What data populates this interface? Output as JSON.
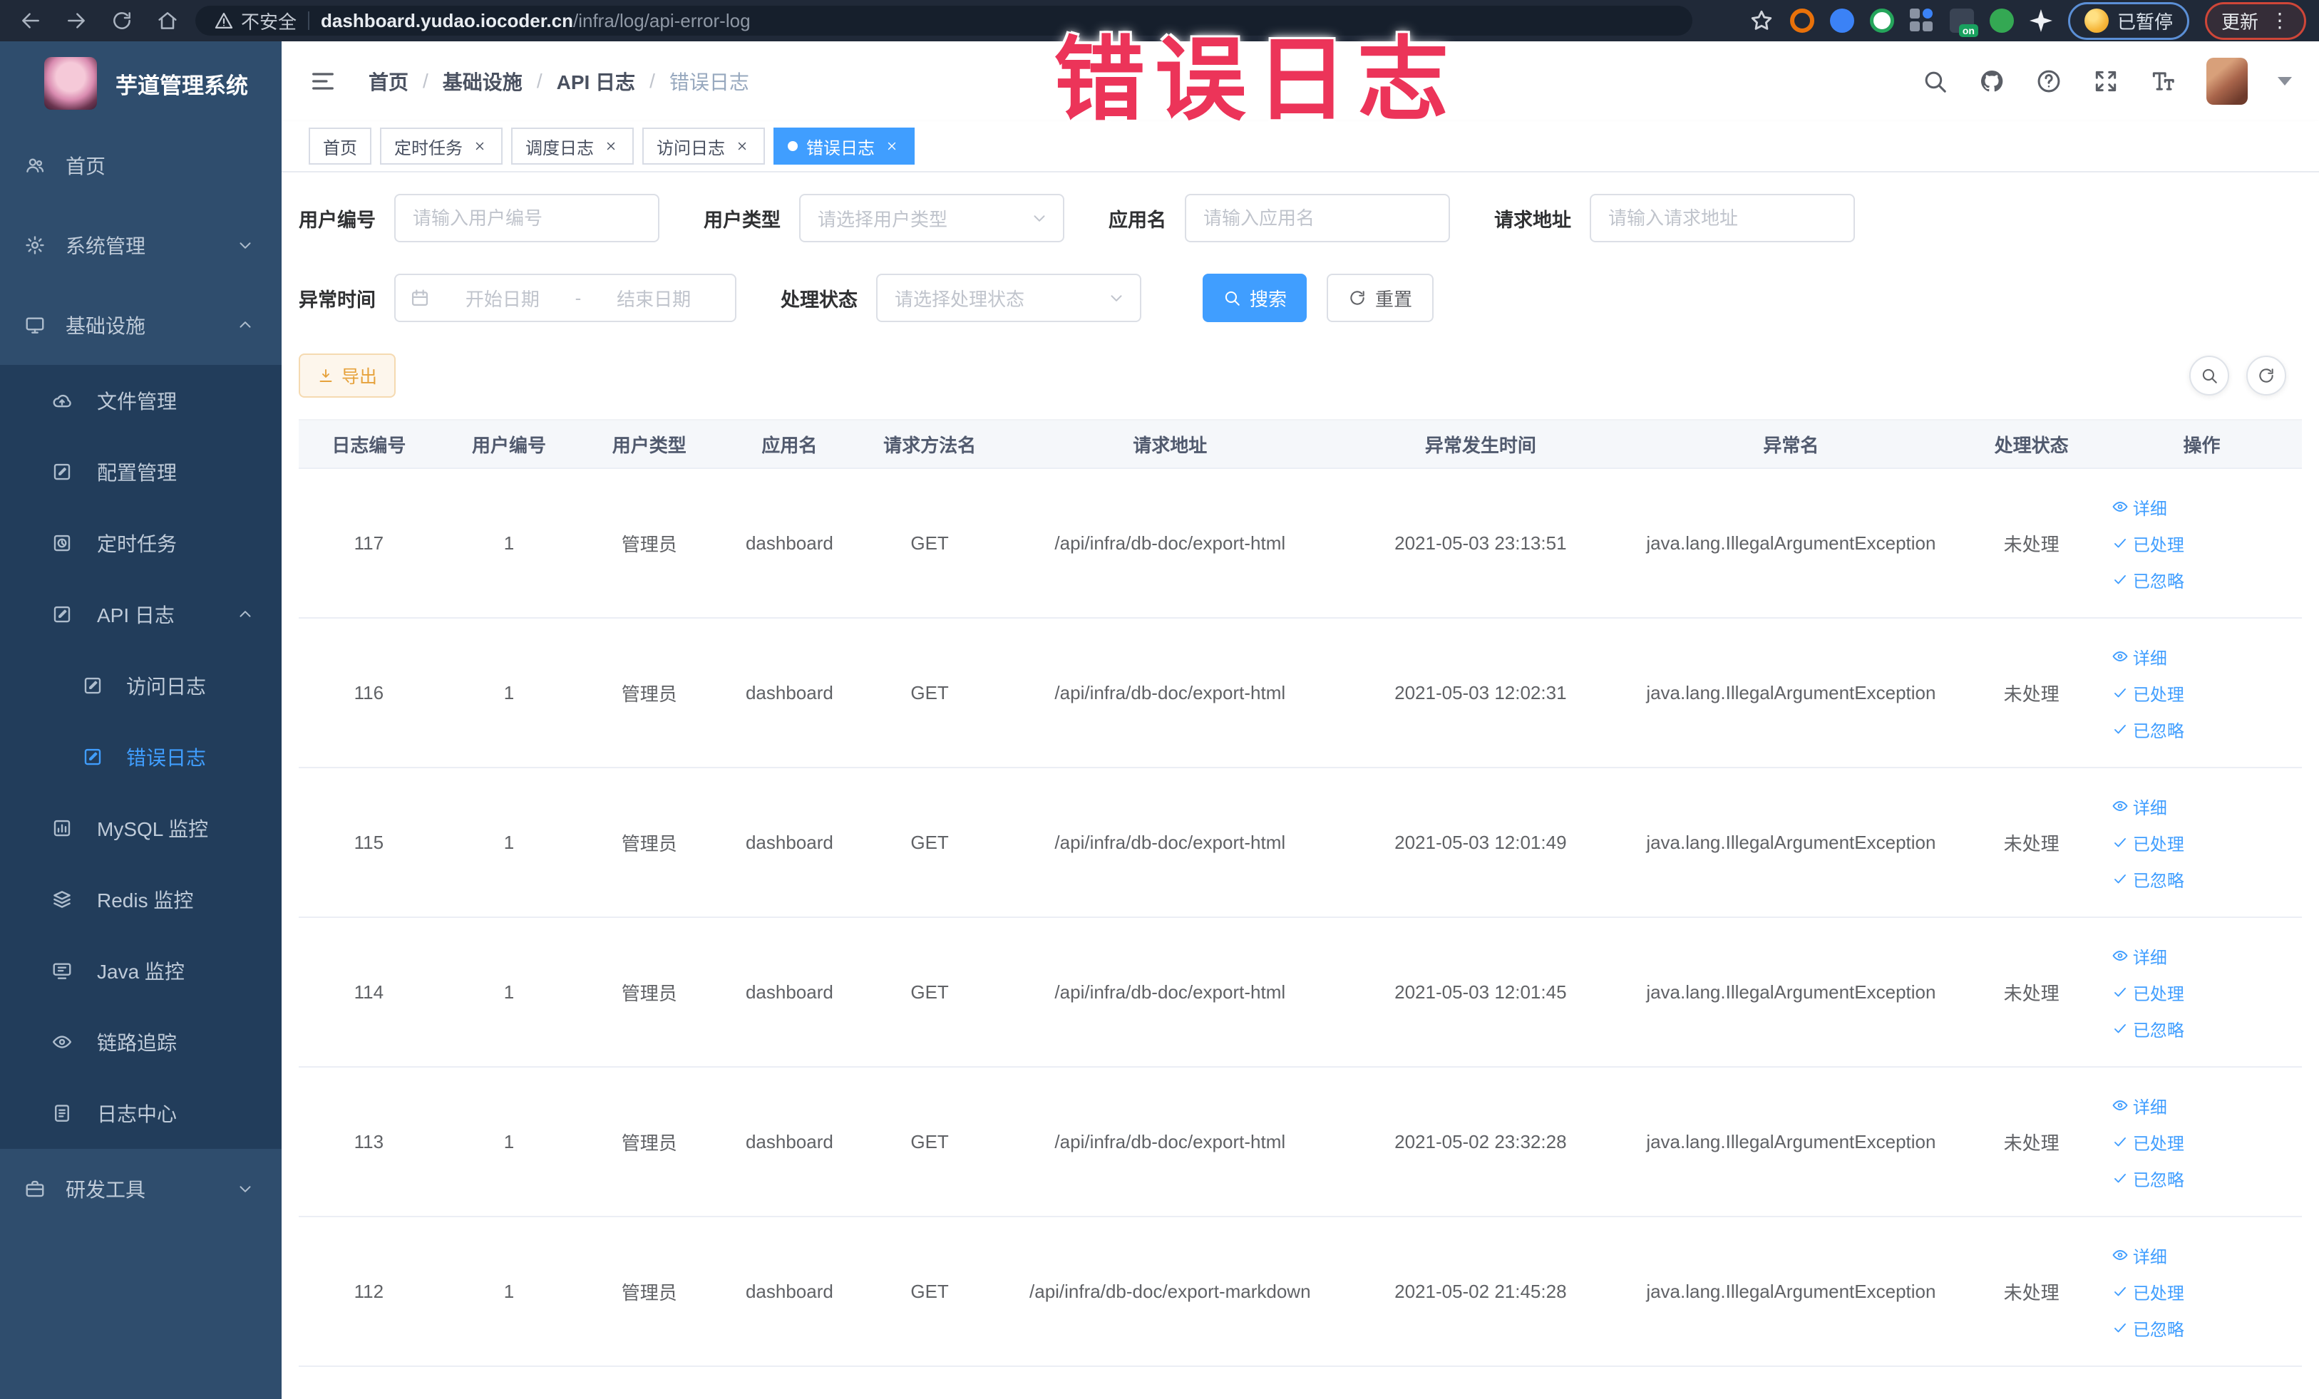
{
  "browser": {
    "security_label": "不安全",
    "url_host": "dashboard.yudao.iocoder.cn",
    "url_path": "/infra/log/api-error-log",
    "paused_badge_label": "已暂停",
    "update_button_label": "更新",
    "extension_on_badge": "on",
    "kebab_glyph": "⋮"
  },
  "annotation": {
    "text": "错误日志",
    "color": "#ec3459"
  },
  "app": {
    "title": "芋道管理系统",
    "breadcrumb": [
      "首页",
      "基础设施",
      "API 日志",
      "错误日志"
    ],
    "breadcrumb_separator": "/"
  },
  "sidebar": {
    "items": [
      {
        "label": "首页",
        "icon": "users",
        "level": 1
      },
      {
        "label": "系统管理",
        "icon": "gear",
        "level": 1,
        "chevron": "down"
      },
      {
        "label": "基础设施",
        "icon": "monitor",
        "level": 1,
        "chevron": "up"
      },
      {
        "label": "文件管理",
        "icon": "cloud",
        "level": 2
      },
      {
        "label": "配置管理",
        "icon": "edit",
        "level": 2
      },
      {
        "label": "定时任务",
        "icon": "timer",
        "level": 2
      },
      {
        "label": "API 日志",
        "icon": "doc",
        "level": 2,
        "chevron": "up"
      },
      {
        "label": "访问日志",
        "icon": "doc",
        "level": 3
      },
      {
        "label": "错误日志",
        "icon": "doc",
        "level": 3,
        "active": true
      },
      {
        "label": "MySQL 监控",
        "icon": "chart",
        "level": 2
      },
      {
        "label": "Redis 监控",
        "icon": "layers",
        "level": 2
      },
      {
        "label": "Java 监控",
        "icon": "display",
        "level": 2
      },
      {
        "label": "链路追踪",
        "icon": "eye",
        "level": 2
      },
      {
        "label": "日志中心",
        "icon": "doclist",
        "level": 2
      },
      {
        "label": "研发工具",
        "icon": "briefcase",
        "level": 1,
        "chevron": "down"
      }
    ]
  },
  "tabs": [
    {
      "label": "首页",
      "closable": false,
      "active": false
    },
    {
      "label": "定时任务",
      "closable": true,
      "active": false
    },
    {
      "label": "调度日志",
      "closable": true,
      "active": false
    },
    {
      "label": "访问日志",
      "closable": true,
      "active": false
    },
    {
      "label": "错误日志",
      "closable": true,
      "active": true
    }
  ],
  "filters": {
    "user_id": {
      "label": "用户编号",
      "placeholder": "请输入用户编号"
    },
    "user_type": {
      "label": "用户类型",
      "placeholder": "请选择用户类型"
    },
    "app_name": {
      "label": "应用名",
      "placeholder": "请输入应用名"
    },
    "request_url": {
      "label": "请求地址",
      "placeholder": "请输入请求地址"
    },
    "exception_time": {
      "label": "异常时间",
      "start_placeholder": "开始日期",
      "separator": "-",
      "end_placeholder": "结束日期"
    },
    "process_status": {
      "label": "处理状态",
      "placeholder": "请选择处理状态"
    },
    "search_label": "搜索",
    "reset_label": "重置"
  },
  "toolbar": {
    "export_label": "导出"
  },
  "table": {
    "columns": [
      "日志编号",
      "用户编号",
      "用户类型",
      "应用名",
      "请求方法名",
      "请求地址",
      "异常发生时间",
      "异常名",
      "处理状态",
      "操作"
    ],
    "row_actions": [
      "详细",
      "已处理",
      "已忽略"
    ],
    "rows": [
      {
        "id": "117",
        "user_id": "1",
        "user_type": "管理员",
        "app": "dashboard",
        "method": "GET",
        "url": "/api/infra/db-doc/export-html",
        "time": "2021-05-03 23:13:51",
        "exception": "java.lang.IllegalArgumentException",
        "status": "未处理"
      },
      {
        "id": "116",
        "user_id": "1",
        "user_type": "管理员",
        "app": "dashboard",
        "method": "GET",
        "url": "/api/infra/db-doc/export-html",
        "time": "2021-05-03 12:02:31",
        "exception": "java.lang.IllegalArgumentException",
        "status": "未处理"
      },
      {
        "id": "115",
        "user_id": "1",
        "user_type": "管理员",
        "app": "dashboard",
        "method": "GET",
        "url": "/api/infra/db-doc/export-html",
        "time": "2021-05-03 12:01:49",
        "exception": "java.lang.IllegalArgumentException",
        "status": "未处理"
      },
      {
        "id": "114",
        "user_id": "1",
        "user_type": "管理员",
        "app": "dashboard",
        "method": "GET",
        "url": "/api/infra/db-doc/export-html",
        "time": "2021-05-03 12:01:45",
        "exception": "java.lang.IllegalArgumentException",
        "status": "未处理"
      },
      {
        "id": "113",
        "user_id": "1",
        "user_type": "管理员",
        "app": "dashboard",
        "method": "GET",
        "url": "/api/infra/db-doc/export-html",
        "time": "2021-05-02 23:32:28",
        "exception": "java.lang.IllegalArgumentException",
        "status": "未处理"
      },
      {
        "id": "112",
        "user_id": "1",
        "user_type": "管理员",
        "app": "dashboard",
        "method": "GET",
        "url": "/api/infra/db-doc/export-markdown",
        "time": "2021-05-02 21:45:28",
        "exception": "java.lang.IllegalArgumentException",
        "status": "未处理"
      }
    ]
  },
  "colors": {
    "accent": "#409eff",
    "sidebar_bg": "#2f4d6d",
    "submenu_bg": "#223d5b",
    "warning_text": "#e6a23c"
  }
}
